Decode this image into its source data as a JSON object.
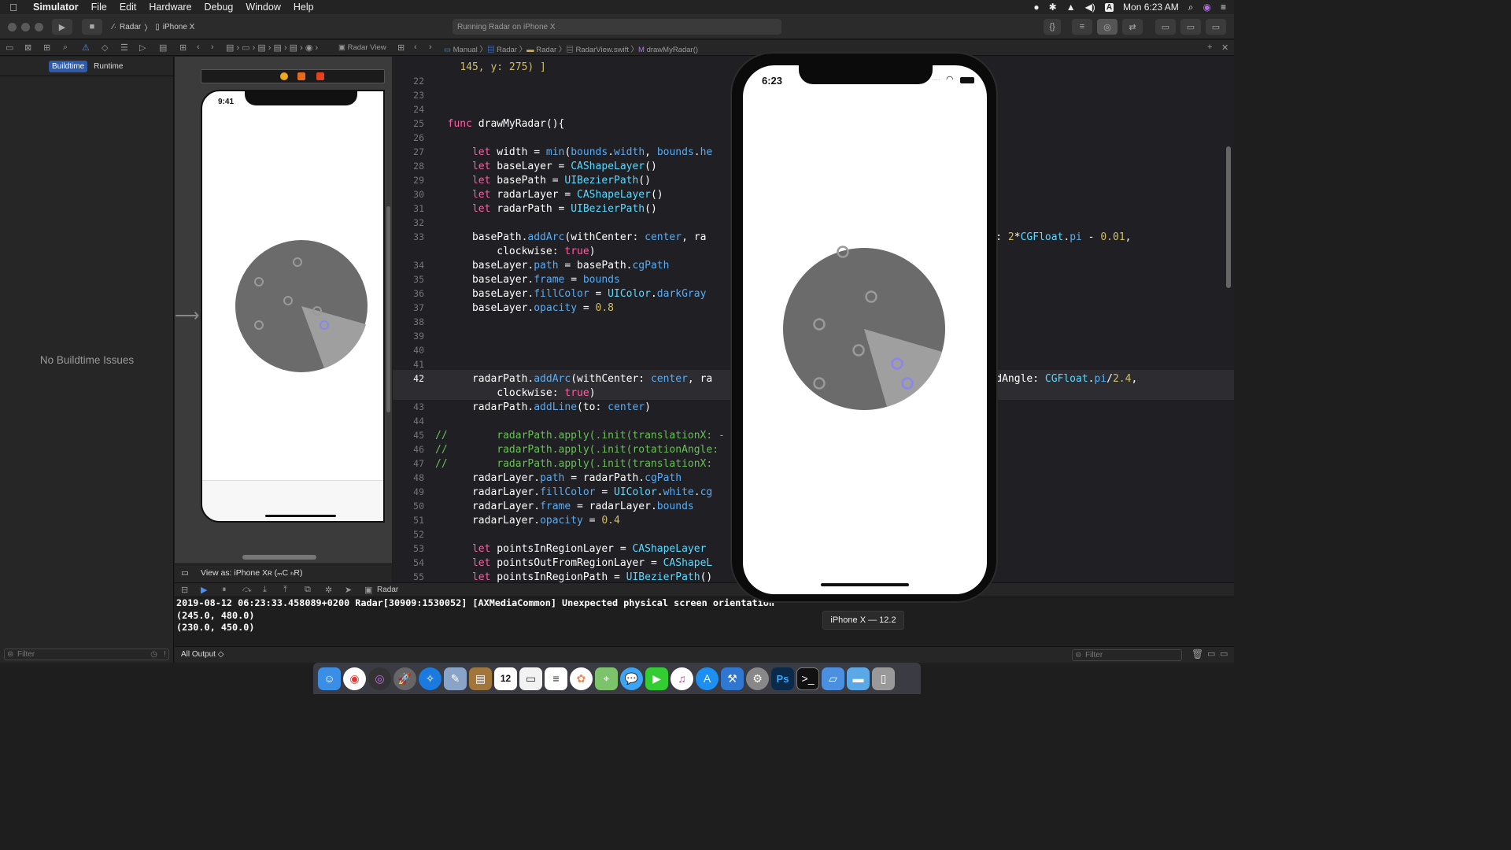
{
  "menubar": {
    "app": "Simulator",
    "items": [
      "File",
      "Edit",
      "Hardware",
      "Debug",
      "Window",
      "Help"
    ],
    "clock": "Mon 6:23 AM",
    "input_indicator": "A"
  },
  "toolbar": {
    "scheme": "Radar",
    "device": "iPhone X",
    "activity": "Running Radar on iPhone X"
  },
  "jumpbar_left": {
    "label": "Radar View"
  },
  "jumpbar_right": {
    "crumbs": [
      "Manual",
      "Radar",
      "Radar",
      "RadarView.swift",
      "drawMyRadar()"
    ]
  },
  "navigator": {
    "tabs": [
      "Buildtime",
      "Runtime"
    ],
    "active_tab": "Buildtime",
    "empty_message": "No Buildtime Issues",
    "filter_placeholder": "Filter"
  },
  "ib": {
    "status_time": "9:41",
    "view_as": "View as: iPhone Xʀ (ₘC ₕR)"
  },
  "editor": {
    "first_line_fragment": "145, y: 275) ]",
    "highlight_line": "42",
    "line_numbers": [
      "22",
      "23",
      "24",
      "25",
      "26",
      "27",
      "28",
      "29",
      "30",
      "31",
      "32",
      "33",
      "",
      "34",
      "35",
      "36",
      "37",
      "38",
      "39",
      "40",
      "41",
      "42",
      "",
      "43",
      "44",
      "45",
      "46",
      "47",
      "48",
      "49",
      "50",
      "51",
      "52",
      "53",
      "54",
      "55"
    ]
  },
  "debug": {
    "target": "Radar",
    "console_lines": [
      "2019-08-12 06:23:33.458089+0200 Radar[30909:1530052] [AXMediaCommon] Unexpected physical screen orientation",
      "(245.0, 480.0)",
      "(230.0, 450.0)"
    ],
    "output_selector": "All Output ◇",
    "filter_placeholder": "Filter"
  },
  "simulator": {
    "status_time": "6:23",
    "device_label": "iPhone X — 12.2"
  },
  "colors": {
    "accent": "#2f5aa7",
    "radar_base": "#6b6b6b",
    "radar_sweep": "#9f9f9f",
    "point_in_region": "#8a86f0"
  },
  "dock": {
    "apps": [
      "finder-icon",
      "chrome-icon",
      "siri-icon",
      "launchpad-icon",
      "safari-icon",
      "preview-icon",
      "notes-icon",
      "calendar-icon",
      "textedit-icon",
      "reminders-icon",
      "photos-icon",
      "maps-icon",
      "messages-icon",
      "facetime-icon",
      "itunes-icon",
      "appstore-icon",
      "xcode-icon",
      "settings-icon",
      "photoshop-icon",
      "terminal-icon",
      "simulator-icon",
      "folder-icon",
      "trash-icon"
    ],
    "calendar_day": "12",
    "photoshop_label": "Ps"
  }
}
